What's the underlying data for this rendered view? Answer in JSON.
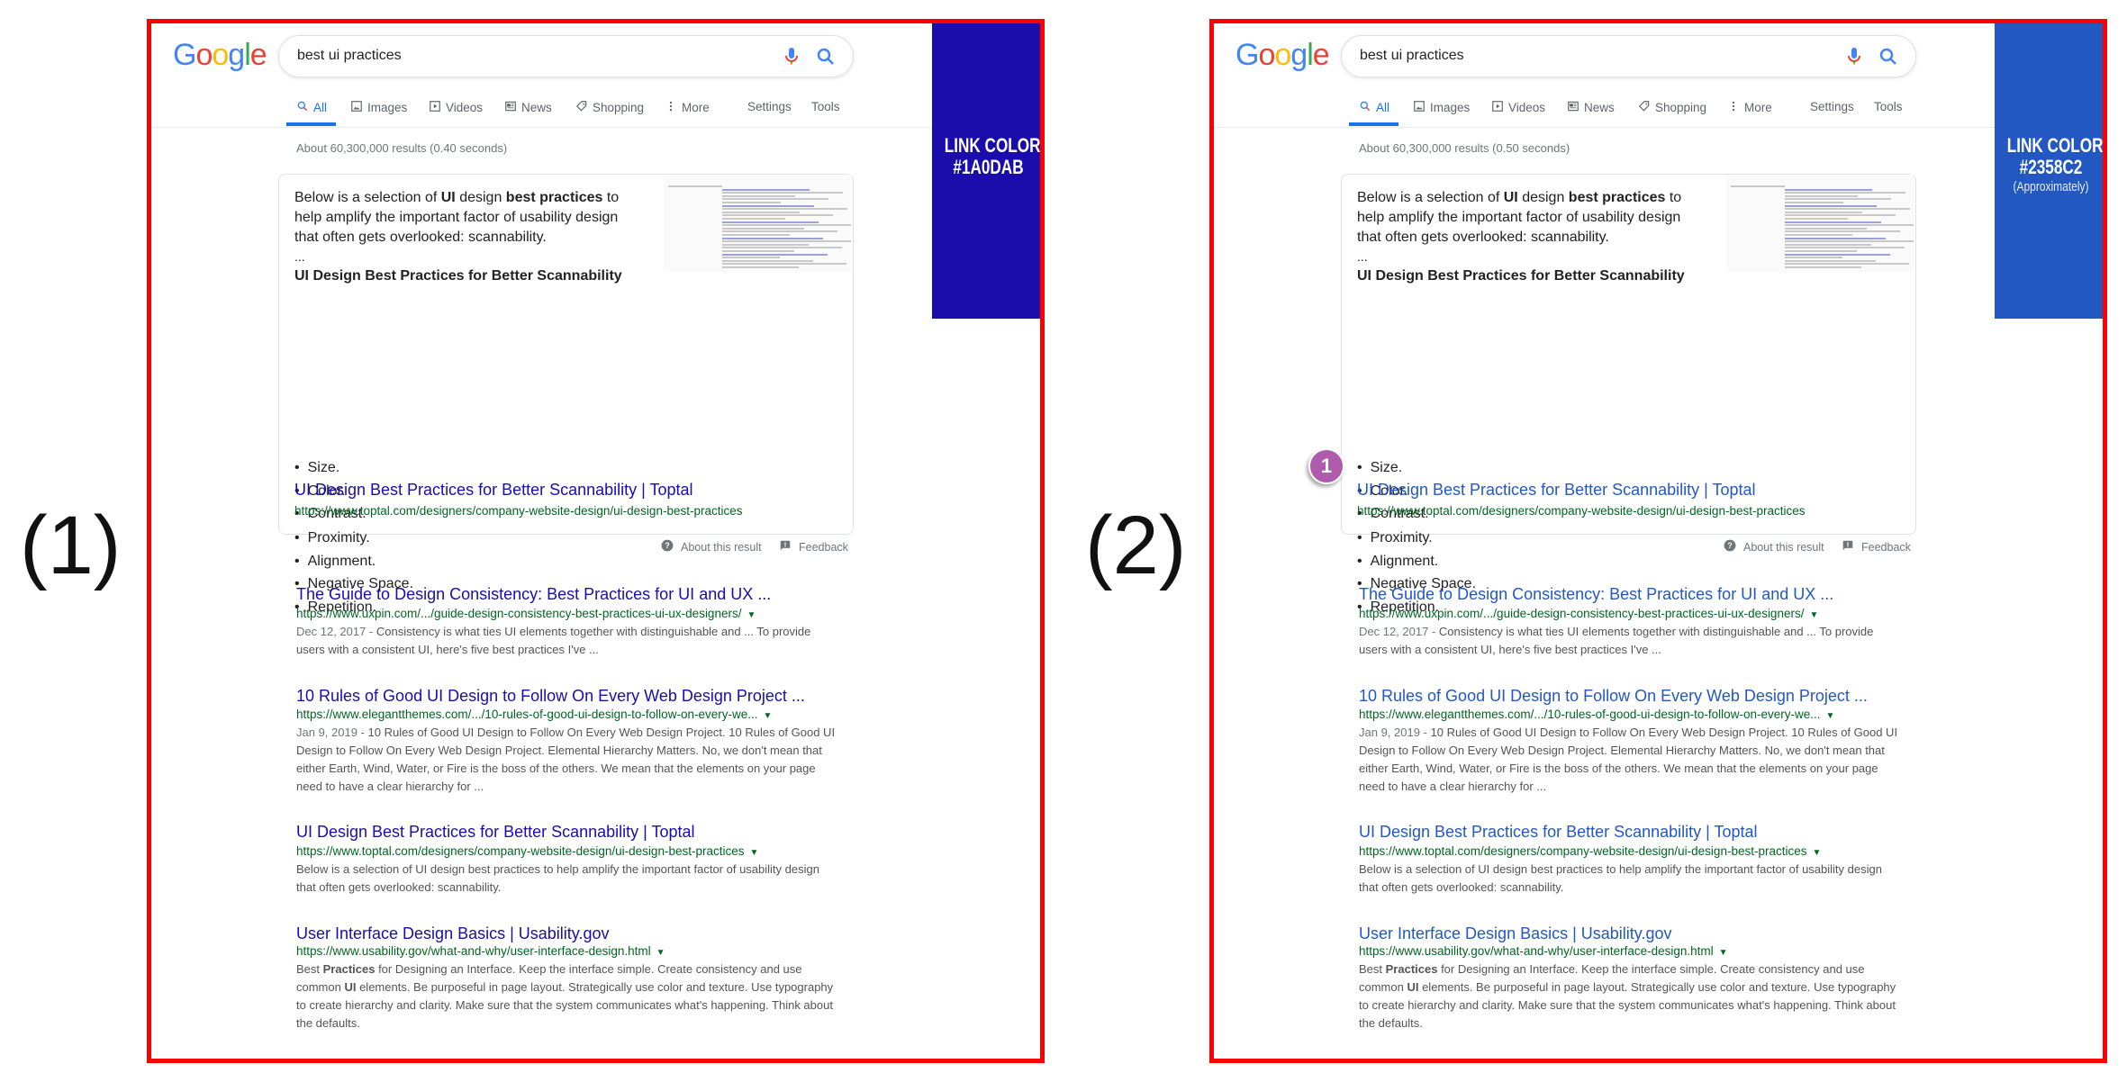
{
  "panels": [
    {
      "label": "(1)",
      "link_color": "#1A0DAB",
      "side_color": "#1A0DAB",
      "side_title": "LINK COLOR",
      "side_code": "#1A0DAB",
      "side_note": null,
      "stats": "About 60,300,000 results (0.40 seconds)",
      "marker": null
    },
    {
      "label": "(2)",
      "link_color": "#2358C2",
      "side_color": "#2358C2",
      "side_title": "LINK COLOR",
      "side_code": "#2358C2",
      "side_note": "(Approximately)",
      "stats": "About 60,300,000 results (0.50 seconds)",
      "marker": "1"
    }
  ],
  "common": {
    "logo": "Google",
    "query": "best ui practices",
    "tabs": [
      "All",
      "Images",
      "Videos",
      "News",
      "Shopping",
      "More",
      "Settings",
      "Tools"
    ],
    "featured": {
      "snippet": [
        {
          "t": "Below is a selection of ",
          "b": false
        },
        {
          "t": "UI",
          "b": true
        },
        {
          "t": " design ",
          "b": false
        },
        {
          "t": "best practices",
          "b": true
        },
        {
          "t": " to help amplify the important factor of usability design that often gets overlooked: scannability.",
          "b": false
        }
      ],
      "ellipsis": "...",
      "heading": "UI Design Best Practices for Better Scannability",
      "bullets": [
        "Size.",
        "Color.",
        "Contrast.",
        "Proximity.",
        "Alignment.",
        "Negative Space.",
        "Repetition."
      ],
      "link": "UI Design Best Practices for Better Scannability | Toptal",
      "url": "https://www.toptal.com/designers/company-website-design/ui-design-best-practices"
    },
    "about_label": "About this result",
    "feedback_label": "Feedback",
    "results": [
      {
        "title": "The Guide to Design Consistency: Best Practices for UI and UX ...",
        "url": "https://www.uxpin.com/.../guide-design-consistency-best-practices-ui-ux-designers/",
        "date": "Dec 12, 2017 - ",
        "snippet": [
          {
            "t": "Consistency is what ties UI elements together with distinguishable and ... To provide users with a consistent UI, here's five best practices I've ...",
            "b": false
          }
        ]
      },
      {
        "title": "10 Rules of Good UI Design to Follow On Every Web Design Project ...",
        "url": "https://www.elegantthemes.com/.../10-rules-of-good-ui-design-to-follow-on-every-we...",
        "date": "Jan 9, 2019 - ",
        "snippet": [
          {
            "t": "10 Rules of Good UI Design to Follow On Every Web Design Project. 10 Rules of Good UI Design to Follow On Every Web Design Project. Elemental Hierarchy Matters. No, we don't mean that either Earth, Wind, Water, or Fire is the boss of the others. We mean that the elements on your page need to have a clear hierarchy for ...",
            "b": false
          }
        ]
      },
      {
        "title": "UI Design Best Practices for Better Scannability | Toptal",
        "url": "https://www.toptal.com/designers/company-website-design/ui-design-best-practices",
        "date": "",
        "snippet": [
          {
            "t": "Below is a selection of UI design best practices to help amplify the important factor of usability design that often gets overlooked: scannability.",
            "b": false
          }
        ]
      },
      {
        "title": "User Interface Design Basics | Usability.gov",
        "url": "https://www.usability.gov/what-and-why/user-interface-design.html",
        "date": "",
        "snippet": [
          {
            "t": "Best ",
            "b": false
          },
          {
            "t": "Practices",
            "b": true
          },
          {
            "t": " for Designing an Interface. Keep the interface simple. Create consistency and use common ",
            "b": false
          },
          {
            "t": "UI",
            "b": true
          },
          {
            "t": " elements. Be purposeful in page layout. Strategically use color and texture. Use typography to create hierarchy and clarity. Make sure that the system communicates what's happening. Think about the defaults.",
            "b": false
          }
        ]
      },
      {
        "title": "A List of UX/UI Best Practices for Websites - Nick Kolenda",
        "url": "",
        "date": "",
        "snippet": []
      }
    ]
  }
}
